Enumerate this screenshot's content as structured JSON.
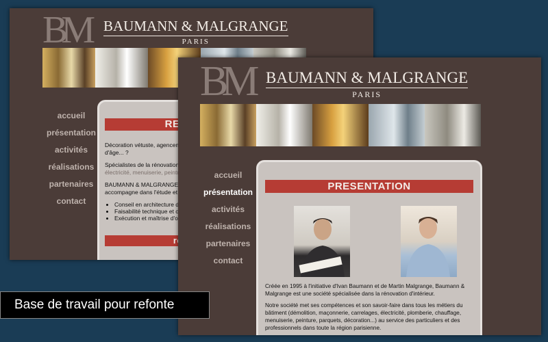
{
  "brand": {
    "monogram": "BM",
    "name": "BAUMANN & MALGRANGE",
    "city": "PARIS"
  },
  "nav": {
    "items": [
      "accueil",
      "présentation",
      "activités",
      "réalisations",
      "partenaires",
      "contact"
    ]
  },
  "back_page": {
    "banner": "RENOVATION",
    "intro": "Décoration vétuste, agencement à revoir, plomberie, électricité hors d'âge... ?",
    "specialists": "Spécialistes de la rénovation",
    "trades": "électricité, menuiserie, peinture",
    "company_line_1": "BAUMANN & MALGRANGE",
    "company_line_2": "accompagne dans l'étude et la",
    "bullets": [
      "Conseil en architecture d",
      "Faisabilité technique et c",
      "Exécution et maîtrise d'o"
    ],
    "banner2": "réalisations"
  },
  "front_page": {
    "banner": "PRESENTATION",
    "para1": "Créée en 1995 à l'initiative d'Ivan Baumann et de Martin Malgrange, Baumann & Malgrange est une société spécialisée dans la rénovation d'intérieur.",
    "para2": "Notre société met ses compétences et son savoir-faire dans tous les métiers du bâtiment (démolition, maçonnerie, carrelages, électricité, plomberie, chauffage, menuiserie, peinture, parquets, décoration...) au service des particuliers et des professionnels dans toute la région parisienne."
  },
  "caption": "Base de travail pour refonte",
  "colors": {
    "background": "#1a3c55",
    "page": "#4b3c38",
    "banner": "#b63c34",
    "panel": "#c9c3bf"
  },
  "photos": [
    "library-room-photo",
    "white-kitchen-photo",
    "bookshelf-lounge-photo",
    "bathroom-photo",
    "dining-room-photo"
  ]
}
